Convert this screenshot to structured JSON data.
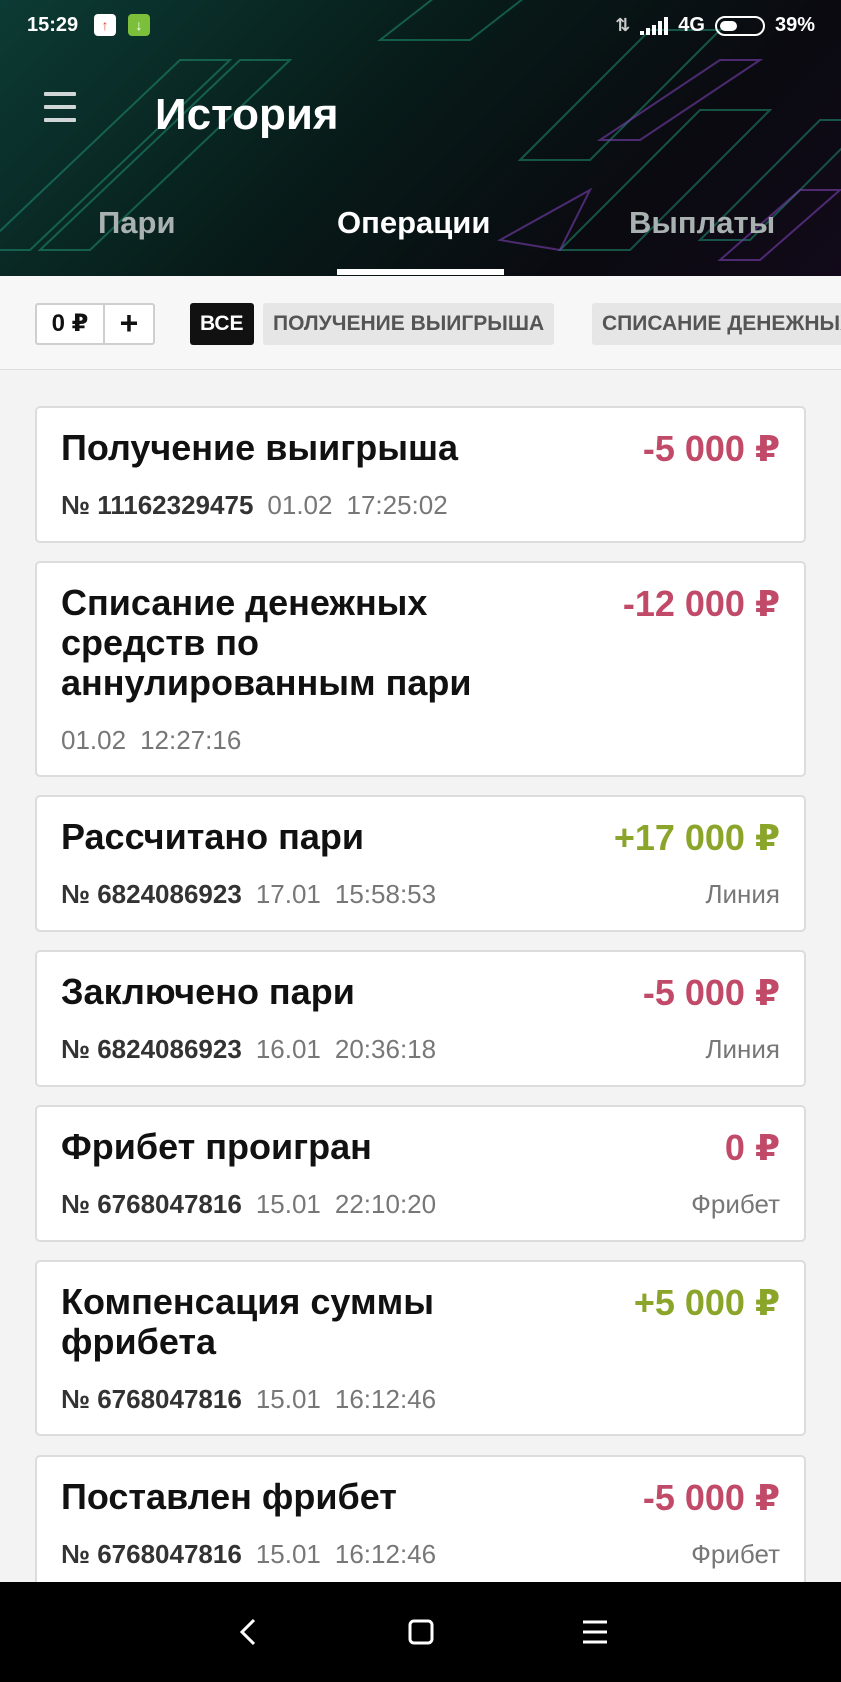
{
  "status_bar": {
    "time": "15:29",
    "network": "4G",
    "battery": "39%"
  },
  "header": {
    "title": "История",
    "tabs": [
      {
        "label": "Пари"
      },
      {
        "label": "Операции"
      },
      {
        "label": "Выплаты"
      }
    ]
  },
  "filter": {
    "amount": "0 ₽",
    "plus": "+",
    "chips": [
      {
        "label": "ВСЕ"
      },
      {
        "label": "ПОЛУЧЕНИЕ ВЫИГРЫША"
      },
      {
        "label": "СПИСАНИЕ ДЕНЕЖНЫХ"
      }
    ]
  },
  "operations": [
    {
      "title": "Получение выигрыша",
      "amount": "-5 000 ₽",
      "number": "№ 11162329475",
      "date": "01.02",
      "time": "17:25:02",
      "type": ""
    },
    {
      "title": "Списание денежных средств по аннулированным пари",
      "amount": "-12 000 ₽",
      "number": "",
      "date": "01.02",
      "time": "12:27:16",
      "type": ""
    },
    {
      "title": "Рассчитано пари",
      "amount": "+17 000 ₽",
      "number": "№ 6824086923",
      "date": "17.01",
      "time": "15:58:53",
      "type": "Линия"
    },
    {
      "title": "Заключено пари",
      "amount": "-5 000 ₽",
      "number": "№ 6824086923",
      "date": "16.01",
      "time": "20:36:18",
      "type": "Линия"
    },
    {
      "title": "Фрибет проигран",
      "amount": "0 ₽",
      "number": "№ 6768047816",
      "date": "15.01",
      "time": "22:10:20",
      "type": "Фрибет"
    },
    {
      "title": "Компенсация суммы фрибета",
      "amount": "+5 000 ₽",
      "number": "№ 6768047816",
      "date": "15.01",
      "time": "16:12:46",
      "type": ""
    },
    {
      "title": "Поставлен фрибет",
      "amount": "-5 000 ₽",
      "number": "№ 6768047816",
      "date": "15.01",
      "time": "16:12:46",
      "type": "Фрибет"
    }
  ],
  "colors": {
    "negative": "#c14a69",
    "positive": "#8aa529"
  }
}
